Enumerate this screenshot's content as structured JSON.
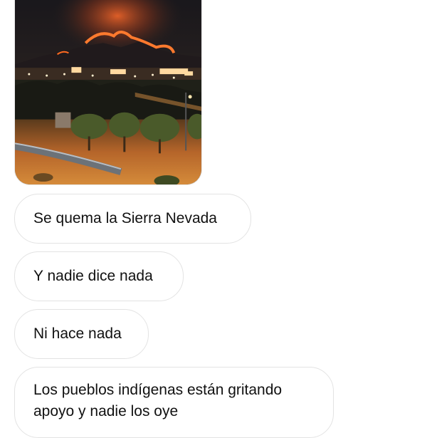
{
  "conversation": {
    "photo": {
      "alt": "photo-message",
      "colors": {
        "sky": "#1c1a1f",
        "fire": "#e2541b",
        "ground": "#c97a2a"
      }
    },
    "messages": [
      {
        "text": "Se quema la Sierra Nevada"
      },
      {
        "text": "Y nadie dice nada"
      },
      {
        "text": "Ni hace nada"
      },
      {
        "text": "Los pueblos indígenas están gritando\napoyo y nadie los oye"
      }
    ]
  }
}
